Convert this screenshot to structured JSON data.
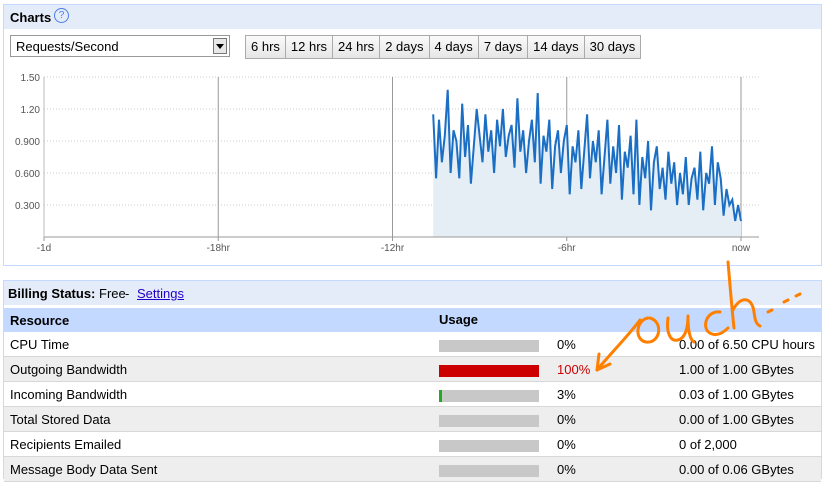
{
  "charts": {
    "title": "Charts",
    "help_icon": "help-icon",
    "metric_selected": "Requests/Second",
    "ranges": [
      "6 hrs",
      "12 hrs",
      "24 hrs",
      "2 days",
      "4 days",
      "7 days",
      "14 days",
      "30 days"
    ]
  },
  "chart_data": {
    "type": "area",
    "title": "",
    "xlabel": "",
    "ylabel": "",
    "x_ticks": [
      "-1d",
      "-18hr",
      "-12hr",
      "-6hr",
      "now"
    ],
    "y_ticks": [
      "1.50",
      "1.20",
      "0.900",
      "0.600",
      "0.300"
    ],
    "ylim": [
      0,
      1.5
    ],
    "xlim": [
      -24,
      0
    ],
    "grid": true,
    "series": [
      {
        "color": "#1a6fc4",
        "fill": "#e6eef5",
        "x": [
          -10.6,
          -10.5,
          -10.4,
          -10.3,
          -10.2,
          -10.1,
          -10.0,
          -9.9,
          -9.8,
          -9.7,
          -9.6,
          -9.5,
          -9.4,
          -9.3,
          -9.2,
          -9.1,
          -9.0,
          -8.9,
          -8.8,
          -8.7,
          -8.6,
          -8.5,
          -8.4,
          -8.3,
          -8.2,
          -8.1,
          -8.0,
          -7.9,
          -7.8,
          -7.7,
          -7.6,
          -7.5,
          -7.4,
          -7.3,
          -7.2,
          -7.1,
          -7.0,
          -6.9,
          -6.8,
          -6.7,
          -6.6,
          -6.5,
          -6.4,
          -6.3,
          -6.2,
          -6.1,
          -6.0,
          -5.9,
          -5.8,
          -5.7,
          -5.6,
          -5.5,
          -5.4,
          -5.3,
          -5.2,
          -5.1,
          -5.0,
          -4.9,
          -4.8,
          -4.7,
          -4.6,
          -4.5,
          -4.4,
          -4.3,
          -4.2,
          -4.1,
          -4.0,
          -3.9,
          -3.8,
          -3.7,
          -3.6,
          -3.5,
          -3.4,
          -3.3,
          -3.2,
          -3.1,
          -3.0,
          -2.9,
          -2.8,
          -2.7,
          -2.6,
          -2.5,
          -2.4,
          -2.3,
          -2.2,
          -2.1,
          -2.0,
          -1.9,
          -1.8,
          -1.7,
          -1.6,
          -1.5,
          -1.4,
          -1.3,
          -1.2,
          -1.1,
          -1.0,
          -0.9,
          -0.8,
          -0.7,
          -0.6,
          -0.5,
          -0.4,
          -0.3,
          -0.2,
          -0.1,
          0.0
        ],
        "y": [
          1.15,
          0.55,
          1.1,
          0.7,
          0.95,
          1.38,
          0.6,
          1.0,
          0.9,
          0.55,
          1.25,
          0.75,
          1.05,
          0.5,
          0.85,
          1.2,
          0.95,
          0.7,
          1.15,
          0.8,
          1.0,
          0.6,
          1.1,
          0.85,
          1.2,
          0.75,
          0.95,
          1.05,
          0.65,
          1.3,
          0.8,
          1.0,
          0.6,
          0.9,
          1.1,
          0.7,
          1.35,
          0.5,
          0.95,
          0.8,
          1.1,
          0.45,
          0.85,
          1.0,
          0.6,
          0.9,
          1.05,
          0.4,
          0.85,
          0.7,
          1.0,
          0.45,
          0.8,
          1.15,
          0.55,
          0.9,
          0.7,
          1.0,
          0.4,
          0.75,
          1.1,
          0.5,
          0.85,
          0.6,
          1.05,
          0.35,
          0.8,
          0.65,
          0.95,
          0.4,
          1.1,
          0.3,
          0.75,
          0.55,
          0.9,
          0.25,
          0.7,
          0.85,
          0.45,
          0.65,
          0.35,
          0.8,
          0.5,
          0.7,
          0.3,
          0.6,
          0.4,
          0.75,
          0.3,
          0.55,
          0.65,
          0.35,
          0.8,
          0.25,
          0.6,
          0.5,
          0.85,
          0.3,
          0.7,
          0.55,
          0.2,
          0.45,
          0.3,
          0.35,
          0.15,
          0.3,
          0.15
        ]
      }
    ]
  },
  "billing": {
    "label": "Billing Status:",
    "value": "Free",
    "dash": "-",
    "settings_link": "Settings",
    "col_resource": "Resource",
    "col_usage": "Usage",
    "colors": {
      "normal": "#c8c8c8",
      "over": "#cc0000",
      "low": "#22aa22"
    },
    "rows": [
      {
        "name": "CPU Time",
        "percent": 0,
        "pct_label": "0%",
        "amount": "0.00 of 6.50 CPU hours"
      },
      {
        "name": "Outgoing Bandwidth",
        "percent": 100,
        "pct_label": "100%",
        "amount": "1.00 of 1.00 GBytes"
      },
      {
        "name": "Incoming Bandwidth",
        "percent": 3,
        "pct_label": "3%",
        "amount": "0.03 of 1.00 GBytes"
      },
      {
        "name": "Total Stored Data",
        "percent": 0,
        "pct_label": "0%",
        "amount": "0.00 of 1.00 GBytes"
      },
      {
        "name": "Recipients Emailed",
        "percent": 0,
        "pct_label": "0%",
        "amount": "0 of 2,000"
      },
      {
        "name": "Message Body Data Sent",
        "percent": 0,
        "pct_label": "0%",
        "amount": "0.00 of 0.06 GBytes"
      }
    ]
  },
  "annotation": {
    "text": "ouch...",
    "color": "#ff8000"
  }
}
